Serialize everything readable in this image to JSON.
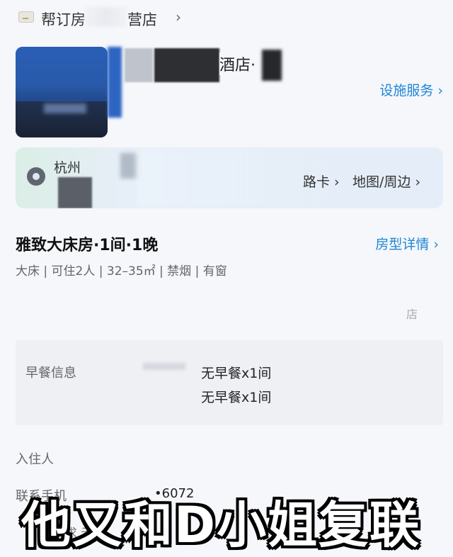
{
  "store": {
    "name_part1": "帮订房",
    "name_part2": "营店",
    "chevron": "›"
  },
  "hotel": {
    "name_fragment": "酒店·",
    "facility_link": "设施服务 ›"
  },
  "address": {
    "city": "杭州",
    "route_link": "路卡 ›",
    "map_link": "地图/周边 ›"
  },
  "room": {
    "title": "雅致大床房·1间·1晚",
    "detail_link": "房型详情 ›",
    "specs": "大床 | 可住2人 | 32–35㎡ | 禁烟 | 有窗"
  },
  "faint": {
    "right": "店"
  },
  "breakfast": {
    "label": "早餐信息",
    "line1": "无早餐x1间",
    "line2": "无早餐x1间"
  },
  "guest": {
    "label": "入住人"
  },
  "contact": {
    "phone_label": "联系手机",
    "phone_value": "•6072"
  },
  "request": {
    "label": "求   无要"
  },
  "caption": {
    "text": "他又和D小姐复联"
  }
}
